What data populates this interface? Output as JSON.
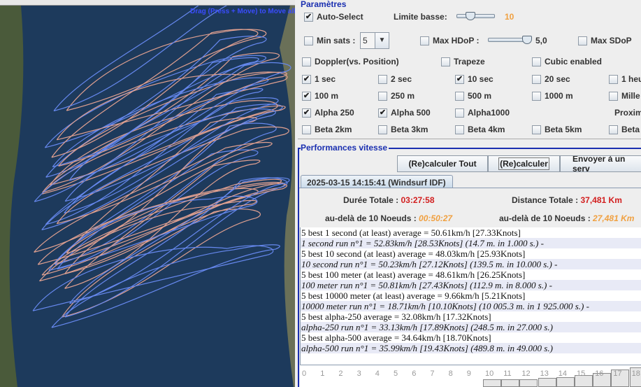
{
  "map": {
    "hint": "Drag (Press + Move) to Move all"
  },
  "params": {
    "title": "Paramètres",
    "auto_select": {
      "label": "Auto-Select",
      "checked": true
    },
    "limite_basse": {
      "label": "Limite basse:",
      "value": "10"
    },
    "min_sats": {
      "label": "Min sats :",
      "value": "5",
      "checked": false
    },
    "max_hdop": {
      "label": "Max HDoP :",
      "value": "5,0",
      "checked": false
    },
    "max_sdop": {
      "label": "Max SDoP",
      "checked": false
    },
    "row3": [
      {
        "label": "Doppler(vs. Position)",
        "checked": false
      },
      {
        "label": "Trapeze",
        "checked": false
      },
      {
        "label": "Cubic enabled",
        "checked": false
      }
    ],
    "row4": [
      {
        "label": "1 sec",
        "checked": true
      },
      {
        "label": "2 sec",
        "checked": false
      },
      {
        "label": "10 sec",
        "checked": true
      },
      {
        "label": "20 sec",
        "checked": false
      },
      {
        "label": "1 heu",
        "checked": false
      }
    ],
    "row5": [
      {
        "label": "100 m",
        "checked": true
      },
      {
        "label": "250 m",
        "checked": false
      },
      {
        "label": "500 m",
        "checked": false
      },
      {
        "label": "1000 m",
        "checked": false
      },
      {
        "label": "Mille",
        "checked": false
      }
    ],
    "row6": [
      {
        "label": "Alpha 250",
        "checked": true
      },
      {
        "label": "Alpha 500",
        "checked": true
      },
      {
        "label": "Alpha1000",
        "checked": false
      }
    ],
    "proxim": "Proxim",
    "row7": [
      {
        "label": "Beta 2km",
        "checked": false
      },
      {
        "label": "Beta 3km",
        "checked": false
      },
      {
        "label": "Beta 4km",
        "checked": false
      },
      {
        "label": "Beta 5km",
        "checked": false
      },
      {
        "label": "Beta",
        "checked": false
      }
    ]
  },
  "perf": {
    "title": "Performances vitesse",
    "buttons": {
      "recalc_all": "(Re)calculer Tout",
      "recalc": "(Re)calculer",
      "send": "Envoyer à un serv"
    },
    "tab": "2025-03-15 14:15:41 (Windsurf IDF)",
    "duree_label": "Durée Totale :",
    "duree": "03:27:58",
    "distance_label": "Distance Totale :",
    "distance": "37,481 Km",
    "above_label": "au-delà de  10 Noeuds :",
    "above_time": "00:50:27",
    "above_dist": "27,481 Km",
    "lines": [
      "5 best 1 second (at least) average = 50.61km/h [27.33Knots]",
      "1 second run n°1 = 52.83km/h [28.53Knots] (14.7 m. in 1.000 s.) -",
      "5 best 10 second (at least) average = 48.03km/h [25.93Knots]",
      "10 second run n°1 = 50.23km/h [27.12Knots] (139.5 m. in 10.000 s.) -",
      "5 best 100 meter (at least) average = 48.61km/h [26.25Knots]",
      "100 meter run n°1 = 50.81km/h [27.43Knots] (112.9 m. in 8.000 s.) -",
      "5 best 10000 meter (at least) average = 9.66km/h [5.21Knots]",
      "10000 meter run n°1 = 18.71km/h [10.10Knots] (10 005.3 m. in 1 925.000 s.) -",
      "5 best alpha-250 average = 32.08km/h [17.32Knots]",
      "alpha-250 run n°1 = 33.13km/h [17.89Knots] (248.5 m. in 27.000 s.)",
      "5 best alpha-500 average = 34.64km/h [18.70Knots]",
      "alpha-500 run n°1 = 35.99km/h [19.43Knots] (489.8 m. in 49.000 s.)"
    ]
  },
  "histogram": {
    "ticks": [
      "0",
      "1",
      "2",
      "3",
      "4",
      "5",
      "6",
      "7",
      "8",
      "9",
      "10",
      "11",
      "12",
      "13",
      "14",
      "15",
      "16",
      "17",
      "18"
    ],
    "bar_levels": [
      0,
      0,
      0,
      0,
      0,
      0,
      0,
      0,
      0,
      0,
      0.4,
      0.4,
      0.4,
      0.45,
      0.5,
      0.6,
      0.7,
      0.9,
      1.0
    ]
  },
  "colors": {
    "accent_orange": "#f0a040",
    "red": "#d21e1e",
    "legend_blue": "#1a2fb0",
    "track_blue": "#6688ee",
    "track_pink": "#e0a090"
  }
}
